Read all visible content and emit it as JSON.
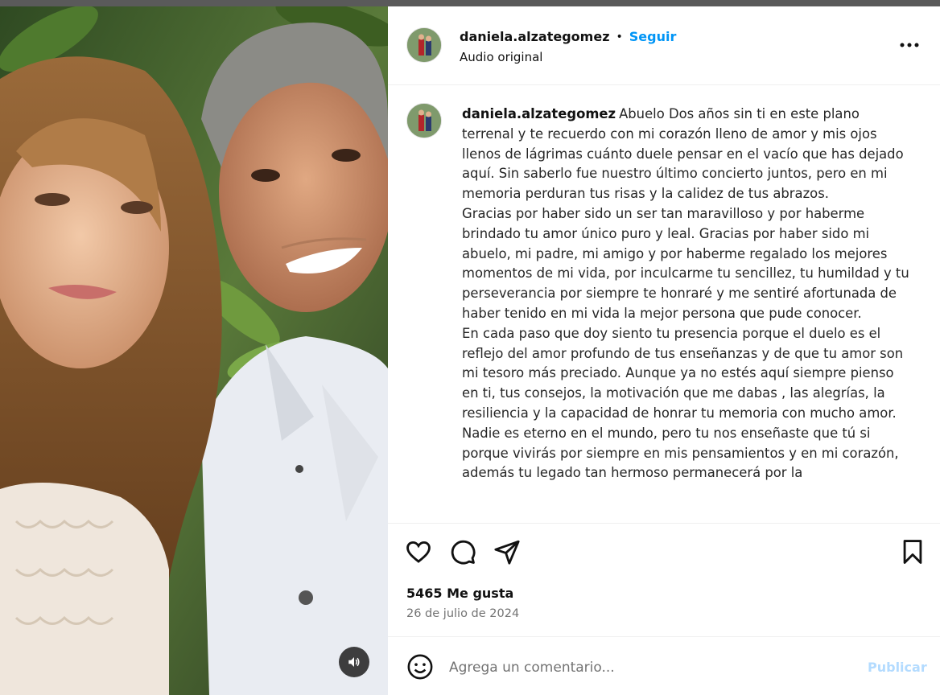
{
  "post": {
    "username": "daniela.alzategomez",
    "follow_label": "Seguir",
    "separator": "•",
    "audio_label": "Audio original",
    "caption": "Abuelo Dos años sin ti en este plano terrenal y te recuerdo con mi corazón lleno de amor y mis ojos llenos de lágrimas cuánto duele pensar en el vacío que has dejado aquí. Sin saberlo fue nuestro último concierto juntos, pero en mi memoria perduran tus risas y la calidez de tus abrazos.\nGracias por haber sido un ser tan maravilloso y por haberme brindado tu amor único puro y leal. Gracias por haber sido mi abuelo, mi padre, mi amigo y por haberme regalado los mejores momentos de mi vida, por inculcarme tu sencillez, tu humildad y tu perseverancia por siempre te honraré y me sentiré afortunada de haber tenido en mi vida la mejor persona que pude conocer.\nEn cada paso que doy siento tu presencia porque el duelo es el reflejo del amor profundo de tus enseñanzas y de que tu amor son mi tesoro más preciado. Aunque ya no estés aquí siempre pienso en ti, tus consejos, la motivación que me dabas , las alegrías, la resiliencia y la capacidad de honrar tu memoria con mucho amor.\nNadie es eterno en el mundo, pero tu nos enseñaste que tú si porque vivirás por siempre en mis pensamientos y en mi corazón, además tu legado tan hermoso permanecerá por la",
    "likes": "5465 Me gusta",
    "date": "26 de julio de 2024"
  },
  "comment": {
    "placeholder": "Agrega un comentario...",
    "publish_label": "Publicar"
  },
  "icons": {
    "more": "more-options-icon",
    "like": "heart-icon",
    "comment": "comment-icon",
    "share": "share-icon",
    "save": "bookmark-icon",
    "emoji": "emoji-icon",
    "mute": "speaker-icon"
  },
  "colors": {
    "accent": "#0095f6",
    "publish_disabled": "#b3dbff",
    "secondary_text": "#737373"
  }
}
